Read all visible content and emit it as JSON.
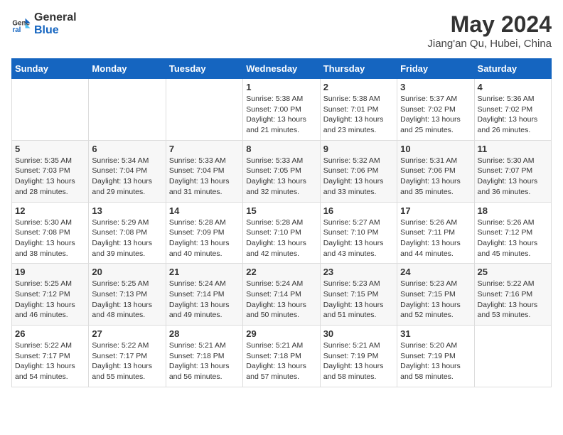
{
  "logo": {
    "line1": "General",
    "line2": "Blue"
  },
  "title": "May 2024",
  "subtitle": "Jiang'an Qu, Hubei, China",
  "weekdays": [
    "Sunday",
    "Monday",
    "Tuesday",
    "Wednesday",
    "Thursday",
    "Friday",
    "Saturday"
  ],
  "weeks": [
    [
      {
        "day": "",
        "sunrise": "",
        "sunset": "",
        "daylight": ""
      },
      {
        "day": "",
        "sunrise": "",
        "sunset": "",
        "daylight": ""
      },
      {
        "day": "",
        "sunrise": "",
        "sunset": "",
        "daylight": ""
      },
      {
        "day": "1",
        "sunrise": "Sunrise: 5:38 AM",
        "sunset": "Sunset: 7:00 PM",
        "daylight": "Daylight: 13 hours and 21 minutes."
      },
      {
        "day": "2",
        "sunrise": "Sunrise: 5:38 AM",
        "sunset": "Sunset: 7:01 PM",
        "daylight": "Daylight: 13 hours and 23 minutes."
      },
      {
        "day": "3",
        "sunrise": "Sunrise: 5:37 AM",
        "sunset": "Sunset: 7:02 PM",
        "daylight": "Daylight: 13 hours and 25 minutes."
      },
      {
        "day": "4",
        "sunrise": "Sunrise: 5:36 AM",
        "sunset": "Sunset: 7:02 PM",
        "daylight": "Daylight: 13 hours and 26 minutes."
      }
    ],
    [
      {
        "day": "5",
        "sunrise": "Sunrise: 5:35 AM",
        "sunset": "Sunset: 7:03 PM",
        "daylight": "Daylight: 13 hours and 28 minutes."
      },
      {
        "day": "6",
        "sunrise": "Sunrise: 5:34 AM",
        "sunset": "Sunset: 7:04 PM",
        "daylight": "Daylight: 13 hours and 29 minutes."
      },
      {
        "day": "7",
        "sunrise": "Sunrise: 5:33 AM",
        "sunset": "Sunset: 7:04 PM",
        "daylight": "Daylight: 13 hours and 31 minutes."
      },
      {
        "day": "8",
        "sunrise": "Sunrise: 5:33 AM",
        "sunset": "Sunset: 7:05 PM",
        "daylight": "Daylight: 13 hours and 32 minutes."
      },
      {
        "day": "9",
        "sunrise": "Sunrise: 5:32 AM",
        "sunset": "Sunset: 7:06 PM",
        "daylight": "Daylight: 13 hours and 33 minutes."
      },
      {
        "day": "10",
        "sunrise": "Sunrise: 5:31 AM",
        "sunset": "Sunset: 7:06 PM",
        "daylight": "Daylight: 13 hours and 35 minutes."
      },
      {
        "day": "11",
        "sunrise": "Sunrise: 5:30 AM",
        "sunset": "Sunset: 7:07 PM",
        "daylight": "Daylight: 13 hours and 36 minutes."
      }
    ],
    [
      {
        "day": "12",
        "sunrise": "Sunrise: 5:30 AM",
        "sunset": "Sunset: 7:08 PM",
        "daylight": "Daylight: 13 hours and 38 minutes."
      },
      {
        "day": "13",
        "sunrise": "Sunrise: 5:29 AM",
        "sunset": "Sunset: 7:08 PM",
        "daylight": "Daylight: 13 hours and 39 minutes."
      },
      {
        "day": "14",
        "sunrise": "Sunrise: 5:28 AM",
        "sunset": "Sunset: 7:09 PM",
        "daylight": "Daylight: 13 hours and 40 minutes."
      },
      {
        "day": "15",
        "sunrise": "Sunrise: 5:28 AM",
        "sunset": "Sunset: 7:10 PM",
        "daylight": "Daylight: 13 hours and 42 minutes."
      },
      {
        "day": "16",
        "sunrise": "Sunrise: 5:27 AM",
        "sunset": "Sunset: 7:10 PM",
        "daylight": "Daylight: 13 hours and 43 minutes."
      },
      {
        "day": "17",
        "sunrise": "Sunrise: 5:26 AM",
        "sunset": "Sunset: 7:11 PM",
        "daylight": "Daylight: 13 hours and 44 minutes."
      },
      {
        "day": "18",
        "sunrise": "Sunrise: 5:26 AM",
        "sunset": "Sunset: 7:12 PM",
        "daylight": "Daylight: 13 hours and 45 minutes."
      }
    ],
    [
      {
        "day": "19",
        "sunrise": "Sunrise: 5:25 AM",
        "sunset": "Sunset: 7:12 PM",
        "daylight": "Daylight: 13 hours and 46 minutes."
      },
      {
        "day": "20",
        "sunrise": "Sunrise: 5:25 AM",
        "sunset": "Sunset: 7:13 PM",
        "daylight": "Daylight: 13 hours and 48 minutes."
      },
      {
        "day": "21",
        "sunrise": "Sunrise: 5:24 AM",
        "sunset": "Sunset: 7:14 PM",
        "daylight": "Daylight: 13 hours and 49 minutes."
      },
      {
        "day": "22",
        "sunrise": "Sunrise: 5:24 AM",
        "sunset": "Sunset: 7:14 PM",
        "daylight": "Daylight: 13 hours and 50 minutes."
      },
      {
        "day": "23",
        "sunrise": "Sunrise: 5:23 AM",
        "sunset": "Sunset: 7:15 PM",
        "daylight": "Daylight: 13 hours and 51 minutes."
      },
      {
        "day": "24",
        "sunrise": "Sunrise: 5:23 AM",
        "sunset": "Sunset: 7:15 PM",
        "daylight": "Daylight: 13 hours and 52 minutes."
      },
      {
        "day": "25",
        "sunrise": "Sunrise: 5:22 AM",
        "sunset": "Sunset: 7:16 PM",
        "daylight": "Daylight: 13 hours and 53 minutes."
      }
    ],
    [
      {
        "day": "26",
        "sunrise": "Sunrise: 5:22 AM",
        "sunset": "Sunset: 7:17 PM",
        "daylight": "Daylight: 13 hours and 54 minutes."
      },
      {
        "day": "27",
        "sunrise": "Sunrise: 5:22 AM",
        "sunset": "Sunset: 7:17 PM",
        "daylight": "Daylight: 13 hours and 55 minutes."
      },
      {
        "day": "28",
        "sunrise": "Sunrise: 5:21 AM",
        "sunset": "Sunset: 7:18 PM",
        "daylight": "Daylight: 13 hours and 56 minutes."
      },
      {
        "day": "29",
        "sunrise": "Sunrise: 5:21 AM",
        "sunset": "Sunset: 7:18 PM",
        "daylight": "Daylight: 13 hours and 57 minutes."
      },
      {
        "day": "30",
        "sunrise": "Sunrise: 5:21 AM",
        "sunset": "Sunset: 7:19 PM",
        "daylight": "Daylight: 13 hours and 58 minutes."
      },
      {
        "day": "31",
        "sunrise": "Sunrise: 5:20 AM",
        "sunset": "Sunset: 7:19 PM",
        "daylight": "Daylight: 13 hours and 58 minutes."
      },
      {
        "day": "",
        "sunrise": "",
        "sunset": "",
        "daylight": ""
      }
    ]
  ]
}
